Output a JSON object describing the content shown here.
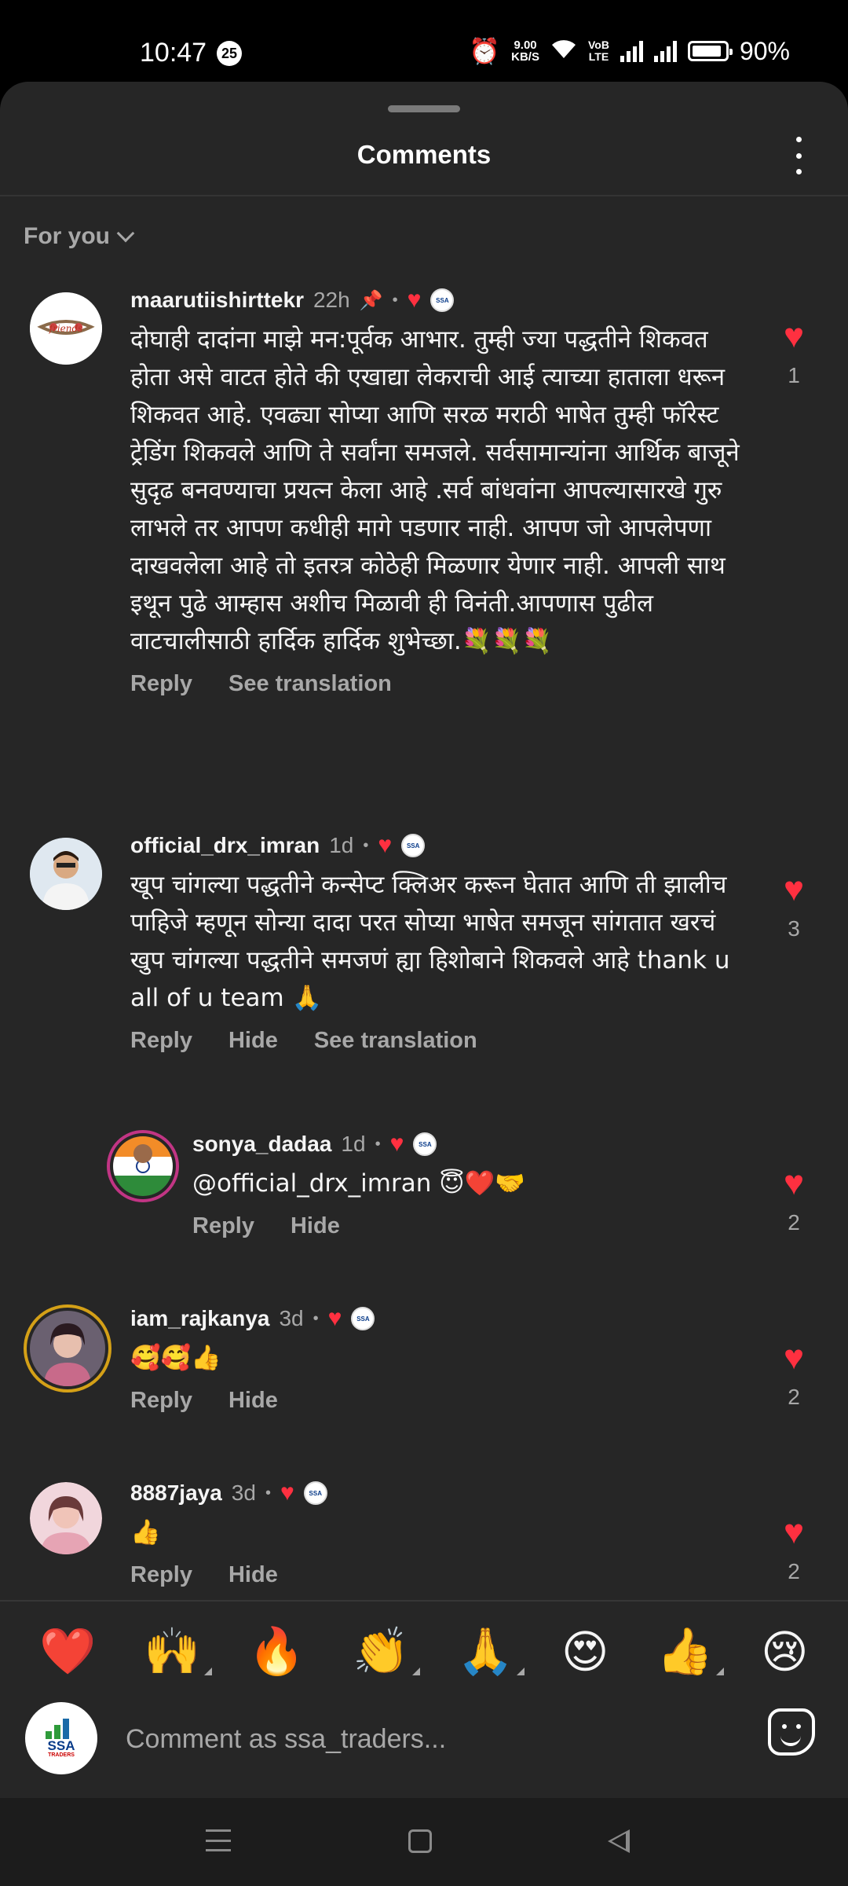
{
  "status_bar": {
    "time": "10:47",
    "notification_count": "25",
    "speed_value": "9.00",
    "speed_unit": "KB/S",
    "volte_top": "VoB",
    "volte_bottom": "LTE",
    "battery": "90%",
    "battery_level": 0.9
  },
  "sheet": {
    "title": "Comments",
    "filter_label": "For you"
  },
  "comments": [
    {
      "username": "maarutiishirttekr",
      "time": "22h",
      "pinned": true,
      "text": "दोघाही दादांना माझे मन:पूर्वक आभार. तुम्ही ज्या पद्धतीने शिकवत होता असे वाटत होते की एखाद्या लेकराची आई त्याच्या हाताला धरून शिकवत आहे. एवढ्या सोप्या आणि सरळ मराठी भाषेत तुम्ही फॉरेस्ट ट्रेडिंग शिकवले आणि ते सर्वांना समजले. सर्वसामान्यांना आर्थिक बाजूने सुदृढ बनवण्याचा प्रयत्न केला आहे .सर्व बांधवांना आपल्यासारखे गुरु लाभले तर आपण कधीही मागे पडणार नाही. आपण जो आपलेपणा दाखवलेला आहे तो इतरत्र कोठेही मिळणार येणार नाही. आपली साथ इथून पुढे आम्हास अशीच मिळावी ही विनंती.आपणास पुढील वाटचालीसाठी हार्दिक हार्दिक शुभेच्छा.💐💐💐",
      "actions": [
        "Reply",
        "See translation"
      ],
      "likes": "1"
    },
    {
      "username": "official_drx_imran",
      "time": "1d",
      "text": "खूप चांगल्या पद्धतीने कन्सेप्ट क्लिअर करून घेतात आणि ती झालीच पाहिजे म्हणून सोन्या दादा परत सोप्या भाषेत समजून सांगतात खरचं खुप चांगल्या पद्धतीने समजणं ह्या हिशोबाने शिकवले आहे thank u all of u team 🙏",
      "actions": [
        "Reply",
        "Hide",
        "See translation"
      ],
      "likes": "3"
    },
    {
      "username": "sonya_dadaa",
      "time": "1d",
      "text": "@official_drx_imran 😇❤️🤝",
      "actions": [
        "Reply",
        "Hide"
      ],
      "likes": "2"
    },
    {
      "username": "iam_rajkanya",
      "time": "3d",
      "text": "🥰🥰👍",
      "actions": [
        "Reply",
        "Hide"
      ],
      "likes": "2"
    },
    {
      "username": "8887jaya",
      "time": "3d",
      "text": "👍",
      "actions": [
        "Reply",
        "Hide"
      ],
      "likes": "2"
    }
  ],
  "reactions": [
    "❤️",
    "🙌",
    "🔥",
    "👏",
    "🙏",
    "😍",
    "👍",
    "😢"
  ],
  "composer": {
    "placeholder": "Comment as ssa_traders...",
    "avatar_text": "SSA",
    "avatar_subtext": "TRADERS"
  },
  "colors": {
    "background": "#262626",
    "like_red": "#ff3040",
    "secondary_text": "#a8a8a8"
  },
  "icons": {
    "sheet_menu": "more-vertical-icon",
    "filter": "chevron-down-icon",
    "like": "heart-icon",
    "pin": "pin-icon",
    "sticker": "sticker-icon"
  }
}
